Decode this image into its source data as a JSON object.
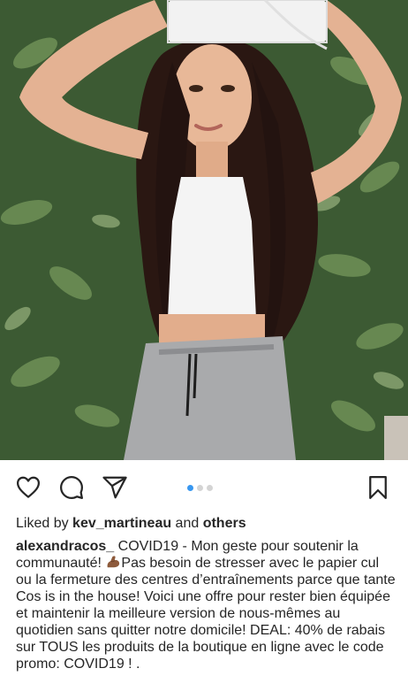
{
  "post": {
    "image_alt": "Woman with long dark hair, white crop top and grey sweatpants, holding a toilet paper roll on her head in front of a leafy green wall",
    "carousel": {
      "total": 3,
      "active_index": 0
    }
  },
  "actions": {
    "like_icon": "heart-icon",
    "comment_icon": "comment-icon",
    "share_icon": "paper-plane-icon",
    "save_icon": "bookmark-icon"
  },
  "likes": {
    "prefix": "Liked by ",
    "user": "kev_martineau",
    "middle": " and ",
    "others": "others"
  },
  "caption": {
    "username": "alexandracos_",
    "text_part1": " COVID19 - Mon geste pour soutenir la communauté! ",
    "emoji_icon": "flexed-biceps-icon",
    "text_part2": "Pas besoin de stresser avec le papier cul ou la fermeture des centres d’entraînements parce que tante Cos is in the house! Voici une offre pour rester bien équipée et maintenir la meilleure version de nous-mêmes au quotidien sans quitter notre domicile! DEAL: 40% de rabais sur TOUS les produits de la boutique en ligne avec le code promo: COVID19 ! ."
  },
  "colors": {
    "active_dot": "#3897f0",
    "inactive_dot": "#d4d4d4",
    "text": "#262626"
  }
}
